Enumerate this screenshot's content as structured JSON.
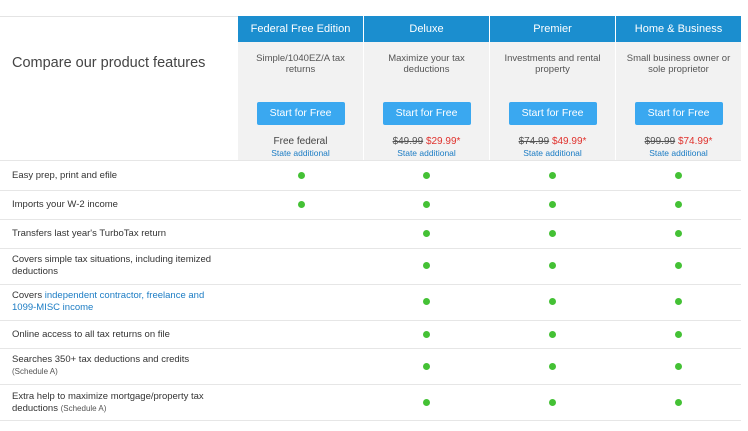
{
  "header": {
    "title": "Compare our product features"
  },
  "products": [
    {
      "name": "Federal Free Edition",
      "description": "Simple/1040EZ/A tax returns",
      "button_label": "Start for Free",
      "price_free": "Free federal",
      "state_text": "State additional"
    },
    {
      "name": "Deluxe",
      "description": "Maximize your tax deductions",
      "button_label": "Start for Free",
      "old_price": "$49.99",
      "new_price": "$29.99*",
      "state_text": "State additional"
    },
    {
      "name": "Premier",
      "description": "Investments and rental property",
      "button_label": "Start for Free",
      "old_price": "$74.99",
      "new_price": "$49.99*",
      "state_text": "State additional"
    },
    {
      "name": "Home & Business",
      "description": "Small business owner or sole proprietor",
      "button_label": "Start for Free",
      "old_price": "$99.99",
      "new_price": "$74.99*",
      "state_text": "State additional"
    }
  ],
  "features": [
    {
      "text": "Easy prep, print and efile",
      "included": [
        true,
        true,
        true,
        true
      ]
    },
    {
      "text": "Imports your W-2 income",
      "included": [
        true,
        true,
        true,
        true
      ]
    },
    {
      "text": "Transfers last year's TurboTax return",
      "included": [
        false,
        true,
        true,
        true
      ]
    },
    {
      "text": "Covers simple tax situations, including itemized deductions",
      "included": [
        false,
        true,
        true,
        true
      ]
    },
    {
      "prefix": "Covers ",
      "link": "independent contractor, freelance and 1099-MISC income",
      "included": [
        false,
        true,
        true,
        true
      ]
    },
    {
      "text": "Online access to all tax returns on file",
      "included": [
        false,
        true,
        true,
        true
      ]
    },
    {
      "text": "Searches 350+ tax deductions and credits",
      "note": "(Schedule A)",
      "included": [
        false,
        true,
        true,
        true
      ]
    },
    {
      "text": "Extra help to maximize mortgage/property tax deductions",
      "note": "(Schedule A)",
      "included": [
        false,
        true,
        true,
        true
      ]
    }
  ],
  "colors": {
    "header_blue": "#1b8ecf",
    "button_blue": "#3aa8f0",
    "check_green": "#44c135",
    "sale_red": "#e0322d",
    "link_blue": "#1b7cc4"
  }
}
